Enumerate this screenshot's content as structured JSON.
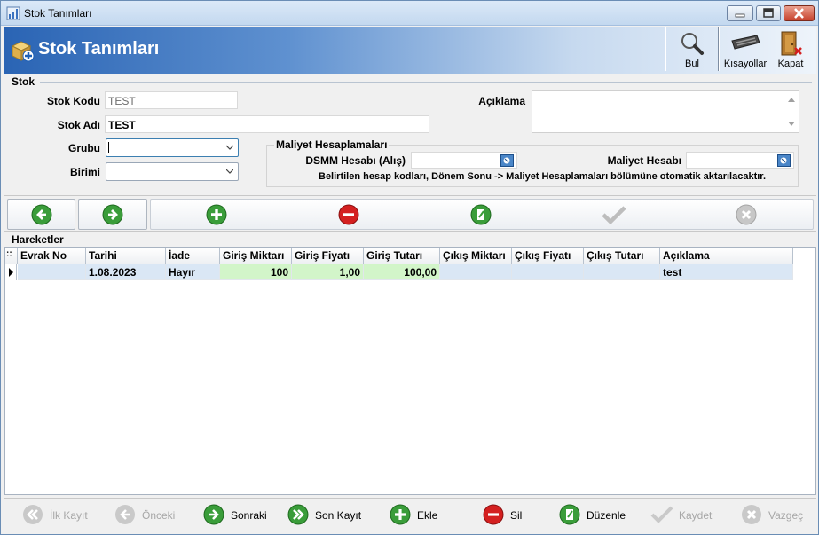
{
  "window": {
    "title": "Stok Tanımları"
  },
  "header": {
    "title": "Stok Tanımları",
    "tools": [
      {
        "label": "Bul",
        "icon": "magnifier-icon"
      },
      {
        "label": "Kısayollar",
        "icon": "keyboard-icon"
      },
      {
        "label": "Kapat",
        "icon": "exit-door-icon"
      }
    ]
  },
  "stok_section": {
    "caption": "Stok",
    "stok_kodu_label": "Stok Kodu",
    "stok_kodu_value": "TEST",
    "stok_adi_label": "Stok Adı",
    "stok_adi_value": "TEST",
    "grubu_label": "Grubu",
    "grubu_value": "",
    "birimi_label": "Birimi",
    "birimi_value": "",
    "aciklama_label": "Açıklama",
    "aciklama_value": ""
  },
  "maliyet": {
    "caption": "Maliyet Hesaplamaları",
    "dsmm_label": "DSMM Hesabı (Alış)",
    "dsmm_value": "",
    "maliyet_label": "Maliyet Hesabı",
    "maliyet_value": "",
    "note": "Belirtilen hesap kodları, Dönem Sonu -> Maliyet Hesaplamaları bölümüne otomatik aktarılacaktır."
  },
  "nav_toolbar": [
    {
      "name": "previous-record-button",
      "icon": "arrow-left-icon"
    },
    {
      "name": "next-record-button",
      "icon": "arrow-right-icon"
    },
    {
      "name": "add-record-button",
      "icon": "plus-icon"
    },
    {
      "name": "delete-record-button",
      "icon": "minus-icon"
    },
    {
      "name": "edit-record-button",
      "icon": "edit-icon"
    },
    {
      "name": "save-record-button",
      "icon": "checkmark-icon"
    },
    {
      "name": "cancel-record-button",
      "icon": "cancel-icon"
    }
  ],
  "grid": {
    "caption": "Hareketler",
    "columns": [
      "Evrak No",
      "Tarihi",
      "İade",
      "Giriş Miktarı",
      "Giriş Fiyatı",
      "Giriş Tutarı",
      "Çıkış Miktarı",
      "Çıkış Fiyatı",
      "Çıkış Tutarı",
      "Açıklama"
    ],
    "rows": [
      [
        "",
        "1.08.2023",
        "Hayır",
        "100",
        "1,00",
        "100,00",
        "",
        "",
        "",
        "test"
      ]
    ]
  },
  "bottom_bar": [
    {
      "label": "İlk Kayıt",
      "enabled": false,
      "icon": "first-record-icon"
    },
    {
      "label": "Önceki",
      "enabled": false,
      "icon": "previous-icon"
    },
    {
      "label": "Sonraki",
      "enabled": true,
      "icon": "next-icon"
    },
    {
      "label": "Son Kayıt",
      "enabled": true,
      "icon": "last-record-icon"
    },
    {
      "label": "Ekle",
      "enabled": true,
      "icon": "add-icon"
    },
    {
      "label": "Sil",
      "enabled": true,
      "icon": "delete-icon"
    },
    {
      "label": "Düzenle",
      "enabled": true,
      "icon": "edit-icon"
    },
    {
      "label": "Kaydet",
      "enabled": false,
      "icon": "save-icon"
    },
    {
      "label": "Vazgeç",
      "enabled": false,
      "icon": "cancel-icon"
    }
  ],
  "colors": {
    "header_blue": "#2a64b4",
    "green_icon": "#2e9b2e",
    "red_icon": "#d42020",
    "row_selected": "#dae7f5",
    "input_column_green": "#d2f5c9"
  }
}
